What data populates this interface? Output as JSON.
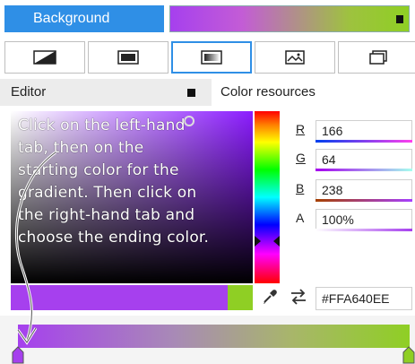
{
  "header": {
    "background_label": "Background"
  },
  "brush_buttons": [
    {
      "icon": "no-brush-icon"
    },
    {
      "icon": "solid-brush-icon"
    },
    {
      "icon": "linear-gradient-icon",
      "selected": true
    },
    {
      "icon": "image-brush-icon"
    },
    {
      "icon": "resource-brush-icon"
    }
  ],
  "tabs": {
    "editor": "Editor",
    "resources": "Color resources"
  },
  "channels": [
    {
      "key": "R",
      "value": "166",
      "underlined": true,
      "bar": "linear-gradient(90deg,#0040ee,#ff40ee)"
    },
    {
      "key": "G",
      "value": "64",
      "underlined": true,
      "bar": "linear-gradient(90deg,#a600ee,#a6ffee)"
    },
    {
      "key": "B",
      "value": "238",
      "underlined": true,
      "bar": "linear-gradient(90deg,#a64000,#a640ff)"
    },
    {
      "key": "A",
      "value": "100%",
      "underlined": false,
      "bar": "linear-gradient(90deg,#ffffff,#a640ee)"
    }
  ],
  "hex_value": "#FFA640EE",
  "colors": {
    "accent": "#2f8fe6",
    "current_color": "#a640ee",
    "previous_color": "#8fcf24",
    "gradient_start": "#a640ee",
    "gradient_end": "#8fcf24"
  },
  "annotation_lines": [
    "Click on the left-hand",
    "tab, then on the",
    "starting color for the",
    "gradient. Then click on",
    "the right-hand tab and",
    "choose the ending color."
  ]
}
